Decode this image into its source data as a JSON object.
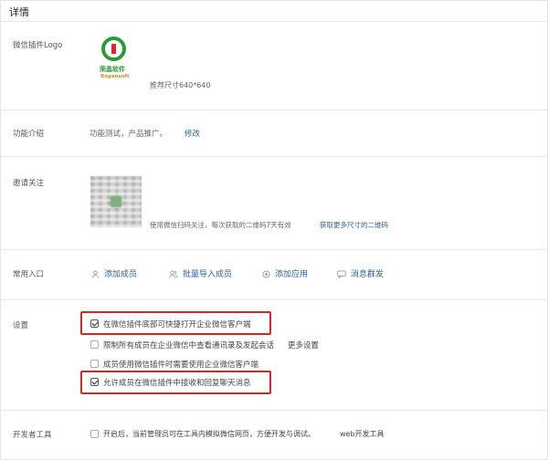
{
  "page": {
    "title": "详情"
  },
  "logo_row": {
    "label": "微信插件Logo",
    "logo_text_cn": "荣晶软件",
    "logo_text_en": "Rogensoft",
    "size_hint": "推荐尺寸640*640"
  },
  "intro_row": {
    "label": "功能介绍",
    "value": "功能测试，产品推广。",
    "edit_link": "修改"
  },
  "invite_row": {
    "label": "邀请关注",
    "hint": "使用微信扫码关注，每次获取的二维码7天有效",
    "more_link": "获取更多尺寸的二维码"
  },
  "shortcuts_row": {
    "label": "常用入口",
    "items": [
      {
        "label": "添加成员",
        "icon": "user-icon"
      },
      {
        "label": "批量导入成员",
        "icon": "users-icon"
      },
      {
        "label": "添加应用",
        "icon": "plus-circle-icon"
      },
      {
        "label": "消息群发",
        "icon": "message-icon"
      }
    ]
  },
  "settings_row": {
    "label": "设置",
    "options": [
      {
        "label": "在微信插件底部可快捷打开企业微信客户端",
        "checked": true,
        "highlighted": true
      },
      {
        "label": "限制所有成员在企业微信中查看通讯录及发起会话",
        "checked": false,
        "highlighted": false,
        "link": "更多设置"
      },
      {
        "label": "成员使用微信插件时需要使用企业微信客户端",
        "checked": false,
        "highlighted": false
      },
      {
        "label": "允许成员在微信插件中接收和回复聊天消息",
        "checked": true,
        "highlighted": true
      }
    ],
    "highlight_color": "#d32626"
  },
  "dev_row": {
    "label": "开发者工具",
    "option": "开启后，当前管理员可在工具内模拟微信网页，方便开发与调试。",
    "link": "web开发工具",
    "checked": false
  },
  "colors": {
    "link": "#2f5f9a",
    "logo_green": "#2b9b3a"
  }
}
